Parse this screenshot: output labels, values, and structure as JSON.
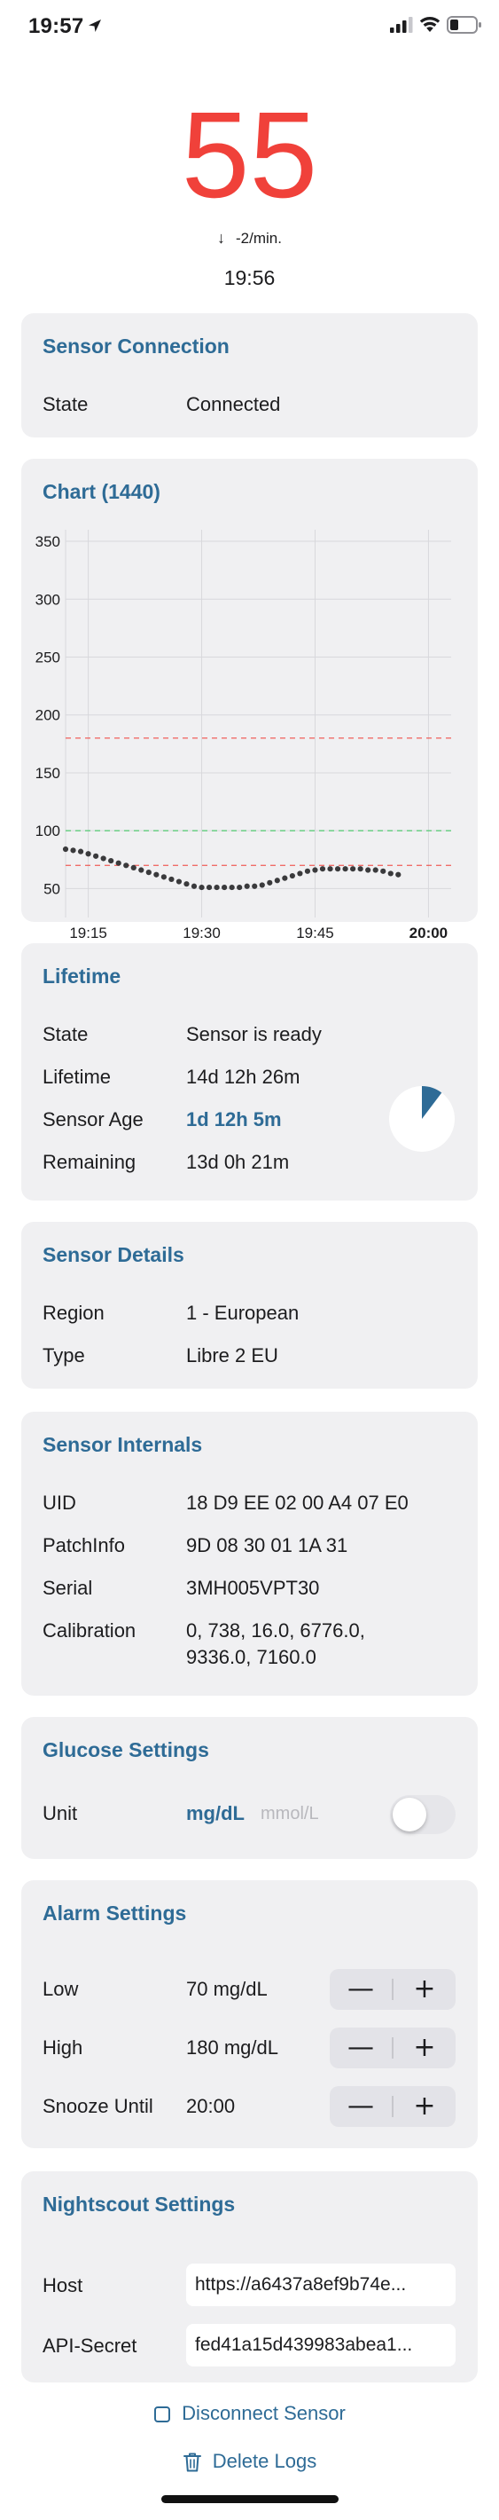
{
  "status_bar": {
    "time": "19:57"
  },
  "header": {
    "glucose_value": "55",
    "trend_arrow": "↓",
    "trend_text": "-2/min.",
    "reading_time": "19:56"
  },
  "colors": {
    "glucose_low": "#f0413a",
    "accent": "#2e6b96",
    "card_bg": "#f0f0f2",
    "alarm_line": "#f0413a",
    "target_line": "#34c759",
    "data_point": "#3a3a3c"
  },
  "sensor_connection": {
    "title": "Sensor Connection",
    "state_label": "State",
    "state_value": "Connected"
  },
  "chart": {
    "title": "Chart (1440)"
  },
  "chart_data": {
    "type": "scatter",
    "title": "Chart (1440)",
    "xlabel": "",
    "ylabel": "",
    "ylim": [
      25,
      360
    ],
    "y_ticks": [
      50,
      100,
      150,
      200,
      250,
      300,
      350
    ],
    "x_ticks": [
      "19:15",
      "19:30",
      "19:45",
      "20:00"
    ],
    "x_range_minutes": [
      "19:12",
      "20:03"
    ],
    "reference_lines": [
      {
        "value": 180,
        "style": "dashed",
        "color": "#f0413a"
      },
      {
        "value": 100,
        "style": "dashed",
        "color": "#34c759"
      },
      {
        "value": 70,
        "style": "dashed",
        "color": "#f0413a"
      }
    ],
    "grid": true,
    "series": [
      {
        "x": [
          "19:12",
          "19:13",
          "19:14",
          "19:15",
          "19:16",
          "19:17",
          "19:18",
          "19:19",
          "19:20",
          "19:21",
          "19:22",
          "19:23",
          "19:24",
          "19:25",
          "19:26",
          "19:27",
          "19:28",
          "19:29",
          "19:30",
          "19:31",
          "19:32",
          "19:33",
          "19:34",
          "19:35",
          "19:36",
          "19:37",
          "19:38",
          "19:39",
          "19:40",
          "19:41",
          "19:42",
          "19:43",
          "19:44",
          "19:45",
          "19:46",
          "19:47",
          "19:48",
          "19:49",
          "19:50",
          "19:51",
          "19:52",
          "19:53",
          "19:54",
          "19:55",
          "19:56"
        ],
        "y": [
          84,
          83,
          82,
          80,
          78,
          76,
          74,
          72,
          70,
          68,
          66,
          64,
          62,
          60,
          58,
          56,
          54,
          52,
          51,
          51,
          51,
          51,
          51,
          51,
          52,
          52,
          53,
          55,
          57,
          59,
          61,
          63,
          65,
          66,
          67,
          67,
          67,
          67,
          67,
          67,
          66,
          66,
          65,
          63,
          62
        ]
      }
    ]
  },
  "lifetime": {
    "title": "Lifetime",
    "rows": [
      {
        "label": "State",
        "value": "Sensor is ready"
      },
      {
        "label": "Lifetime",
        "value": "14d 12h 26m"
      },
      {
        "label": "Sensor Age",
        "value": "1d 12h 5m"
      },
      {
        "label": "Remaining",
        "value": "13d 0h 21m"
      }
    ],
    "age_fraction": 0.103
  },
  "sensor_details": {
    "title": "Sensor Details",
    "rows": [
      {
        "label": "Region",
        "value": "1 - European"
      },
      {
        "label": "Type",
        "value": "Libre 2 EU"
      }
    ]
  },
  "sensor_internals": {
    "title": "Sensor Internals",
    "rows": [
      {
        "label": "UID",
        "value": "18 D9 EE 02 00 A4 07 E0"
      },
      {
        "label": "PatchInfo",
        "value": "9D 08 30 01 1A 31"
      },
      {
        "label": "Serial",
        "value": "3MH005VPT30"
      },
      {
        "label": "Calibration",
        "value": "0, 738, 16.0, 6776.0,"
      },
      {
        "label": "",
        "value": "9336.0, 7160.0"
      }
    ]
  },
  "glucose_settings": {
    "title": "Glucose Settings",
    "unit_label": "Unit",
    "unit_active": "mg/dL",
    "unit_inactive": "mmol/L",
    "toggle_on": false
  },
  "alarm_settings": {
    "title": "Alarm Settings",
    "rows": [
      {
        "label": "Low",
        "value": "70 mg/dL"
      },
      {
        "label": "High",
        "value": "180 mg/dL"
      },
      {
        "label": "Snooze Until",
        "value": "20:00"
      }
    ],
    "minus": "—",
    "plus": "+"
  },
  "nightscout_settings": {
    "title": "Nightscout Settings",
    "host_label": "Host",
    "host_value": "https://a6437a8ef9b74e...",
    "secret_label": "API-Secret",
    "secret_value": "fed41a15d439983abea1..."
  },
  "actions": {
    "disconnect": "Disconnect Sensor",
    "delete_logs": "Delete Logs"
  }
}
